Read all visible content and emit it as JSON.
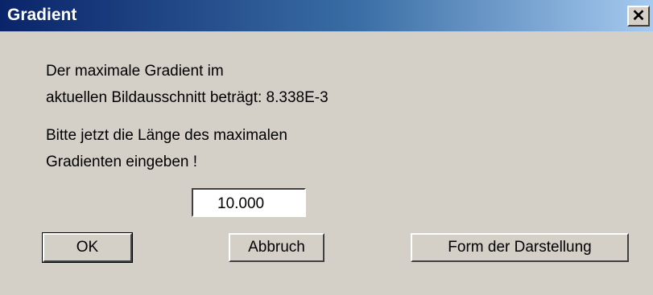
{
  "window": {
    "title": "Gradient",
    "close_glyph": "✕"
  },
  "message": {
    "line1": "Der maximale Gradient im",
    "line2": "aktuellen Bildausschnitt beträgt:  8.338E-3",
    "line3": "Bitte jetzt die Länge des maximalen",
    "line4": "Gradienten eingeben !"
  },
  "input": {
    "value": "10.000"
  },
  "buttons": {
    "ok": "OK",
    "cancel": "Abbruch",
    "form": "Form der Darstellung"
  }
}
